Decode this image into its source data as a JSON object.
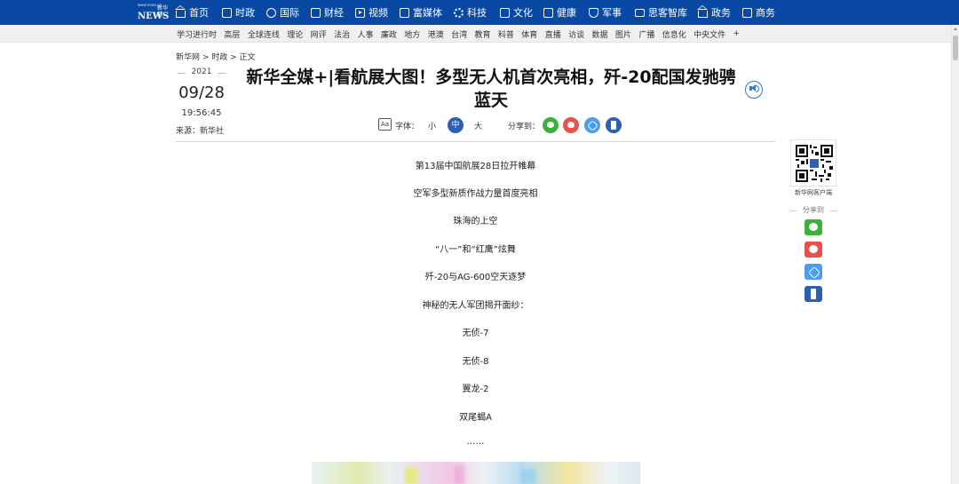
{
  "logo": {
    "small_text": "www.news.cn",
    "letters": "NEWS",
    "cn": "新华网"
  },
  "topnav": [
    {
      "label": "首页",
      "icon": "home-icon"
    },
    {
      "label": "时政",
      "icon": "document-icon"
    },
    {
      "label": "国际",
      "icon": "globe-icon"
    },
    {
      "label": "财经",
      "icon": "bar-chart-icon"
    },
    {
      "label": "视频",
      "icon": "play-icon"
    },
    {
      "label": "富媒体",
      "icon": "grid-icon"
    },
    {
      "label": "科技",
      "icon": "gear-icon"
    },
    {
      "label": "文化",
      "icon": "book-icon"
    },
    {
      "label": "健康",
      "icon": "heart-icon"
    },
    {
      "label": "军事",
      "icon": "shield-icon"
    },
    {
      "label": "思客智库",
      "icon": "chat-icon"
    },
    {
      "label": "政务",
      "icon": "building-icon"
    },
    {
      "label": "商务",
      "icon": "briefcase-icon"
    }
  ],
  "subnav": [
    "学习进行时",
    "高层",
    "全球连线",
    "理论",
    "网评",
    "法治",
    "人事",
    "廉政",
    "地方",
    "港澳",
    "台湾",
    "教育",
    "科普",
    "体育",
    "直播",
    "访谈",
    "数据",
    "图片",
    "广播",
    "信息化",
    "中央文件",
    "+"
  ],
  "breadcrumb": "新华网 > 时政 > 正文",
  "date": {
    "year": "2021",
    "month_day": "09/28",
    "time": "19:56:45",
    "source": "来源：新华社"
  },
  "article": {
    "title": "新华全媒+|看航展大图！多型无人机首次亮相，歼-20配国发驰骋蓝天",
    "paragraphs": [
      "第13届中国航展28日拉开帷幕",
      "空军多型新质作战力量首度亮相",
      "珠海的上空",
      "“八一”和“红鹰”炫舞",
      "歼-20与AG-600空天逐梦",
      "神秘的无人军团揭开面纱：",
      "无侦-7",
      "无侦-8",
      "翼龙-2",
      "双尾蝎A",
      "……"
    ]
  },
  "tools": {
    "font_icon": "Aa",
    "font_label": "字体：",
    "size_small": "小",
    "size_medium": "中",
    "size_large": "大",
    "share_label": "分享到："
  },
  "sidebar": {
    "qr_caption": "新华网客户端",
    "share_label": "分享到"
  },
  "colors": {
    "nav_bg": "#0a49a3",
    "accent": "#2d5fb4",
    "wechat": "#3bb13b",
    "weibo": "#e9524a",
    "link": "#4c9cf0"
  }
}
